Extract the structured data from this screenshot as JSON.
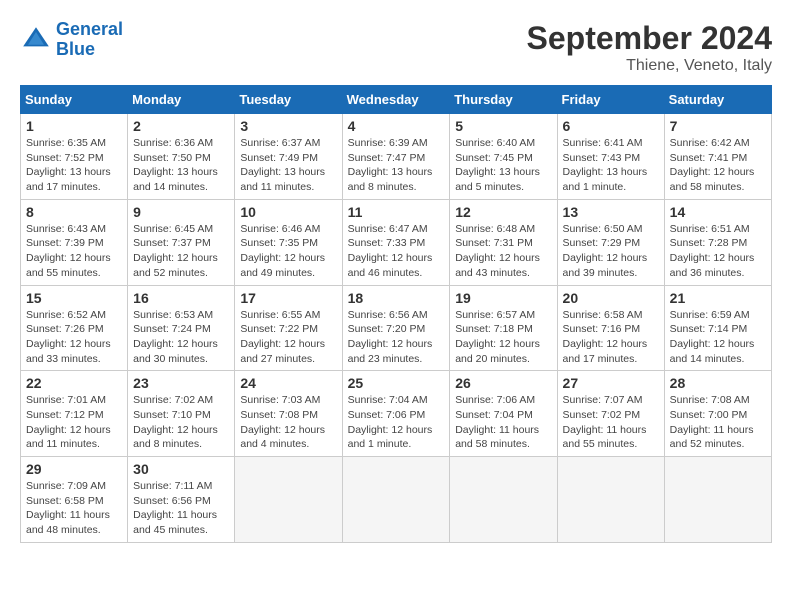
{
  "header": {
    "logo_line1": "General",
    "logo_line2": "Blue",
    "month_title": "September 2024",
    "location": "Thiene, Veneto, Italy"
  },
  "weekdays": [
    "Sunday",
    "Monday",
    "Tuesday",
    "Wednesday",
    "Thursday",
    "Friday",
    "Saturday"
  ],
  "weeks": [
    [
      {
        "day": "1",
        "sunrise": "Sunrise: 6:35 AM",
        "sunset": "Sunset: 7:52 PM",
        "daylight": "Daylight: 13 hours and 17 minutes."
      },
      {
        "day": "2",
        "sunrise": "Sunrise: 6:36 AM",
        "sunset": "Sunset: 7:50 PM",
        "daylight": "Daylight: 13 hours and 14 minutes."
      },
      {
        "day": "3",
        "sunrise": "Sunrise: 6:37 AM",
        "sunset": "Sunset: 7:49 PM",
        "daylight": "Daylight: 13 hours and 11 minutes."
      },
      {
        "day": "4",
        "sunrise": "Sunrise: 6:39 AM",
        "sunset": "Sunset: 7:47 PM",
        "daylight": "Daylight: 13 hours and 8 minutes."
      },
      {
        "day": "5",
        "sunrise": "Sunrise: 6:40 AM",
        "sunset": "Sunset: 7:45 PM",
        "daylight": "Daylight: 13 hours and 5 minutes."
      },
      {
        "day": "6",
        "sunrise": "Sunrise: 6:41 AM",
        "sunset": "Sunset: 7:43 PM",
        "daylight": "Daylight: 13 hours and 1 minute."
      },
      {
        "day": "7",
        "sunrise": "Sunrise: 6:42 AM",
        "sunset": "Sunset: 7:41 PM",
        "daylight": "Daylight: 12 hours and 58 minutes."
      }
    ],
    [
      {
        "day": "8",
        "sunrise": "Sunrise: 6:43 AM",
        "sunset": "Sunset: 7:39 PM",
        "daylight": "Daylight: 12 hours and 55 minutes."
      },
      {
        "day": "9",
        "sunrise": "Sunrise: 6:45 AM",
        "sunset": "Sunset: 7:37 PM",
        "daylight": "Daylight: 12 hours and 52 minutes."
      },
      {
        "day": "10",
        "sunrise": "Sunrise: 6:46 AM",
        "sunset": "Sunset: 7:35 PM",
        "daylight": "Daylight: 12 hours and 49 minutes."
      },
      {
        "day": "11",
        "sunrise": "Sunrise: 6:47 AM",
        "sunset": "Sunset: 7:33 PM",
        "daylight": "Daylight: 12 hours and 46 minutes."
      },
      {
        "day": "12",
        "sunrise": "Sunrise: 6:48 AM",
        "sunset": "Sunset: 7:31 PM",
        "daylight": "Daylight: 12 hours and 43 minutes."
      },
      {
        "day": "13",
        "sunrise": "Sunrise: 6:50 AM",
        "sunset": "Sunset: 7:29 PM",
        "daylight": "Daylight: 12 hours and 39 minutes."
      },
      {
        "day": "14",
        "sunrise": "Sunrise: 6:51 AM",
        "sunset": "Sunset: 7:28 PM",
        "daylight": "Daylight: 12 hours and 36 minutes."
      }
    ],
    [
      {
        "day": "15",
        "sunrise": "Sunrise: 6:52 AM",
        "sunset": "Sunset: 7:26 PM",
        "daylight": "Daylight: 12 hours and 33 minutes."
      },
      {
        "day": "16",
        "sunrise": "Sunrise: 6:53 AM",
        "sunset": "Sunset: 7:24 PM",
        "daylight": "Daylight: 12 hours and 30 minutes."
      },
      {
        "day": "17",
        "sunrise": "Sunrise: 6:55 AM",
        "sunset": "Sunset: 7:22 PM",
        "daylight": "Daylight: 12 hours and 27 minutes."
      },
      {
        "day": "18",
        "sunrise": "Sunrise: 6:56 AM",
        "sunset": "Sunset: 7:20 PM",
        "daylight": "Daylight: 12 hours and 23 minutes."
      },
      {
        "day": "19",
        "sunrise": "Sunrise: 6:57 AM",
        "sunset": "Sunset: 7:18 PM",
        "daylight": "Daylight: 12 hours and 20 minutes."
      },
      {
        "day": "20",
        "sunrise": "Sunrise: 6:58 AM",
        "sunset": "Sunset: 7:16 PM",
        "daylight": "Daylight: 12 hours and 17 minutes."
      },
      {
        "day": "21",
        "sunrise": "Sunrise: 6:59 AM",
        "sunset": "Sunset: 7:14 PM",
        "daylight": "Daylight: 12 hours and 14 minutes."
      }
    ],
    [
      {
        "day": "22",
        "sunrise": "Sunrise: 7:01 AM",
        "sunset": "Sunset: 7:12 PM",
        "daylight": "Daylight: 12 hours and 11 minutes."
      },
      {
        "day": "23",
        "sunrise": "Sunrise: 7:02 AM",
        "sunset": "Sunset: 7:10 PM",
        "daylight": "Daylight: 12 hours and 8 minutes."
      },
      {
        "day": "24",
        "sunrise": "Sunrise: 7:03 AM",
        "sunset": "Sunset: 7:08 PM",
        "daylight": "Daylight: 12 hours and 4 minutes."
      },
      {
        "day": "25",
        "sunrise": "Sunrise: 7:04 AM",
        "sunset": "Sunset: 7:06 PM",
        "daylight": "Daylight: 12 hours and 1 minute."
      },
      {
        "day": "26",
        "sunrise": "Sunrise: 7:06 AM",
        "sunset": "Sunset: 7:04 PM",
        "daylight": "Daylight: 11 hours and 58 minutes."
      },
      {
        "day": "27",
        "sunrise": "Sunrise: 7:07 AM",
        "sunset": "Sunset: 7:02 PM",
        "daylight": "Daylight: 11 hours and 55 minutes."
      },
      {
        "day": "28",
        "sunrise": "Sunrise: 7:08 AM",
        "sunset": "Sunset: 7:00 PM",
        "daylight": "Daylight: 11 hours and 52 minutes."
      }
    ],
    [
      {
        "day": "29",
        "sunrise": "Sunrise: 7:09 AM",
        "sunset": "Sunset: 6:58 PM",
        "daylight": "Daylight: 11 hours and 48 minutes."
      },
      {
        "day": "30",
        "sunrise": "Sunrise: 7:11 AM",
        "sunset": "Sunset: 6:56 PM",
        "daylight": "Daylight: 11 hours and 45 minutes."
      },
      null,
      null,
      null,
      null,
      null
    ]
  ]
}
